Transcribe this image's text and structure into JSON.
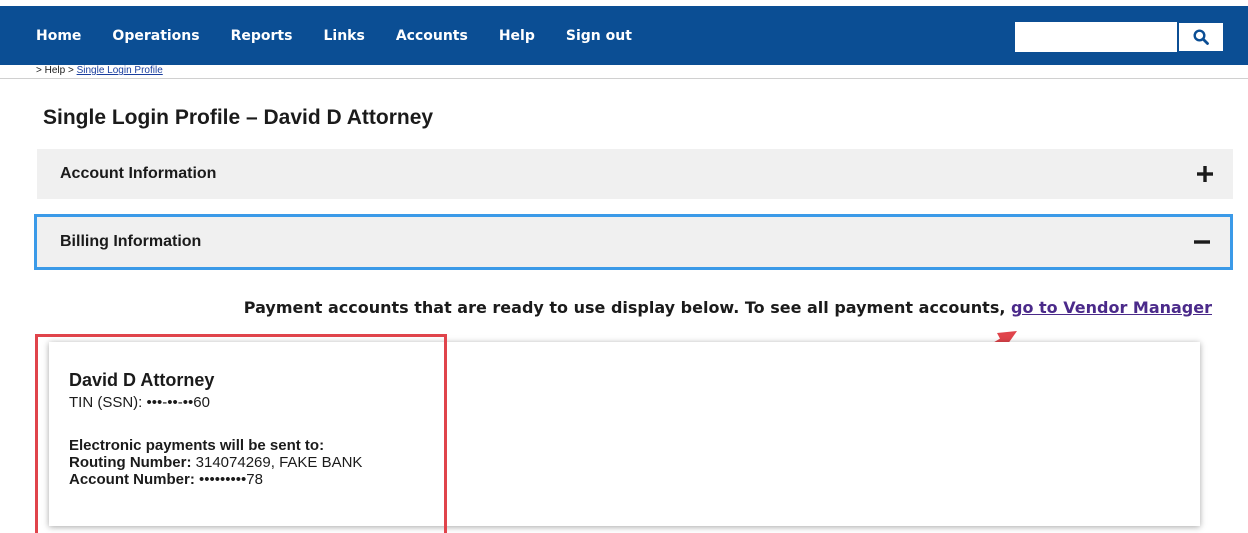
{
  "nav": {
    "items": [
      "Home",
      "Operations",
      "Reports",
      "Links",
      "Accounts",
      "Help",
      "Sign out"
    ],
    "search_placeholder": "",
    "search_icon": "search-icon"
  },
  "breadcrumb": {
    "prefix": "> Help >",
    "current": "Single Login Profile"
  },
  "page": {
    "title": "Single Login Profile – David D Attorney"
  },
  "accordions": {
    "account": {
      "label": "Account Information",
      "state": "collapsed",
      "toggle": "+"
    },
    "billing": {
      "label": "Billing Information",
      "state": "expanded",
      "toggle": "−"
    }
  },
  "billing": {
    "note": "Payment accounts that are ready to use display below. To see all payment accounts,",
    "vendor_link": "go to Vendor Manager",
    "card": {
      "name": "David D Attorney",
      "tin_label": "TIN (SSN):",
      "tin_value": "•••-••-••60",
      "epay_heading": "Electronic payments will be sent to:",
      "routing_label": "Routing Number:",
      "routing_value": "314074269, FAKE BANK",
      "account_label": "Account Number:",
      "account_value": "•••••••••78"
    }
  },
  "colors": {
    "nav_bg": "#0b4e94",
    "focus_border": "#3b9ae8",
    "annotation_red": "#e0444b",
    "link_visited": "#4b2a8a"
  }
}
